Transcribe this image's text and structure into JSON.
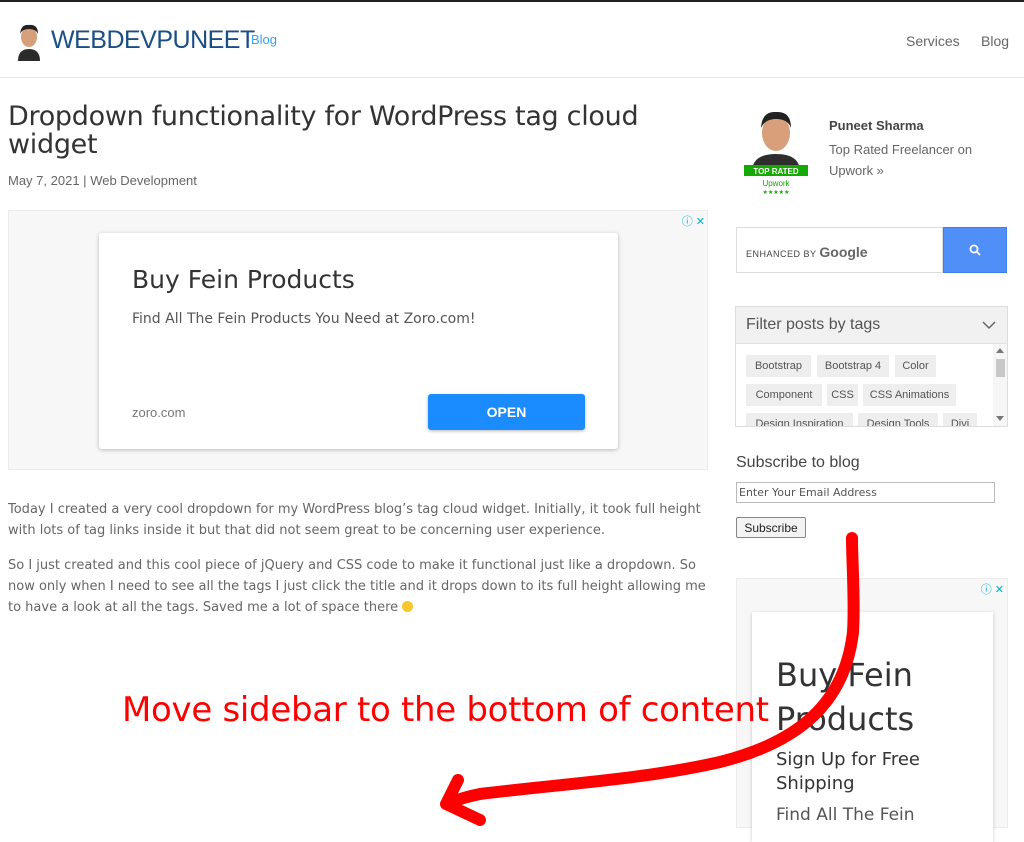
{
  "header": {
    "logo_text": "WEBDEVPUNEET",
    "logo_sup": "Blog",
    "nav": [
      "Services",
      "Blog"
    ]
  },
  "post": {
    "title": "Dropdown functionality for WordPress tag cloud widget",
    "date": "May 7, 2021",
    "separator": "|",
    "category": "Web Development",
    "paragraphs": [
      "Today I created a very cool dropdown for my WordPress blog’s tag cloud widget. Initially, it took full height with lots of tag links inside it but that did not seem great to be concerning user experience.",
      "So I just created and this cool piece of jQuery and CSS code to make it functional just like a dropdown. So now only when I need to see all the tags I just click the title and it drops down to its full height allowing me to have a look at all the tags. Saved me a lot of space there"
    ]
  },
  "ad_main": {
    "headline": "Buy Fein Products",
    "description": "Find All The Fein Products You Need at Zoro.com!",
    "domain": "zoro.com",
    "cta": "OPEN",
    "choices": "ⓘ ✕"
  },
  "sidebar": {
    "profile": {
      "name": "Puneet Sharma",
      "description": "Top Rated Freelancer on Upwork »",
      "badge_top": "TOP RATED",
      "badge_brand": "Upwork"
    },
    "search": {
      "label_prefix": "ENHANCED BY",
      "label_brand": "Google"
    },
    "tags": {
      "title": "Filter posts by tags",
      "items": [
        "Bootstrap",
        "Bootstrap 4",
        "Color",
        "Component",
        "CSS",
        "CSS Animations",
        "Design Inspiration",
        "Design Tools",
        "Divi"
      ]
    },
    "subscribe": {
      "title": "Subscribe to blog",
      "placeholder": "Enter Your Email Address",
      "button": "Subscribe"
    },
    "ad": {
      "headline": "Buy Fein Products",
      "subline": "Sign Up for Free Shipping",
      "description": "Find All The Fein",
      "choices": "ⓘ ✕"
    }
  },
  "annotation": {
    "text": "Move sidebar to the bottom of content",
    "color": "#ff0000"
  },
  "colors": {
    "logo": "#1a4e86",
    "accent": "#2ea3f2",
    "ad_button": "#1a8cff",
    "search_button": "#4f8ff7"
  }
}
